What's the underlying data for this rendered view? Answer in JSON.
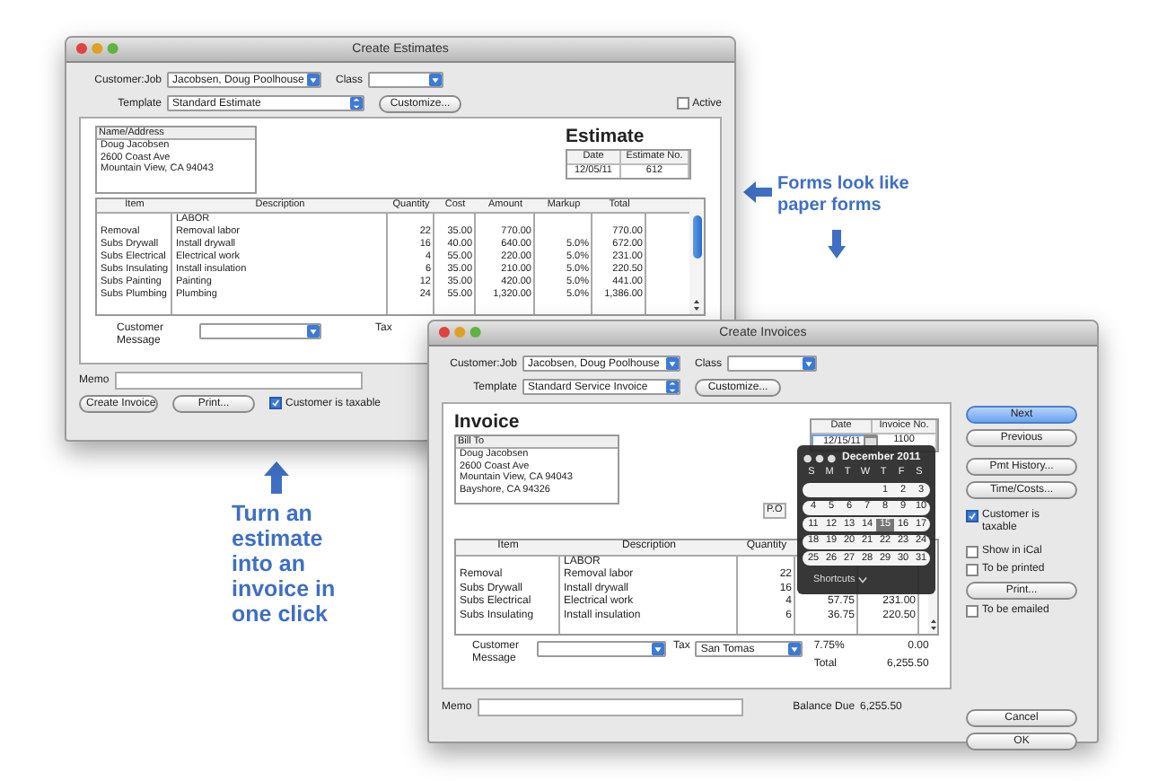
{
  "callout_right": "Forms look like paper forms",
  "callout_left": "Turn an estimate into an invoice in one click",
  "estimate_window": {
    "title": "Create Estimates",
    "customer_job_label": "Customer:Job",
    "customer_job": "Jacobsen, Doug Poolhouse",
    "class_label": "Class",
    "template_label": "Template",
    "template": "Standard Estimate",
    "customize_button": "Customize...",
    "active": {
      "label": "Active",
      "checked": false
    },
    "name_address_label": "Name/Address",
    "address_lines": [
      "Doug Jacobsen",
      "2600 Coast Ave",
      "Mountain View, CA 94043"
    ],
    "form_title": "Estimate",
    "date_label": "Date",
    "date": "12/05/11",
    "number_label": "Estimate No.",
    "number": "612",
    "columns": [
      "Item",
      "Description",
      "Quantity",
      "Cost",
      "Amount",
      "Markup",
      "Total"
    ],
    "rows": [
      {
        "description": "LABOR"
      },
      {
        "item": "Removal",
        "description": "Removal labor",
        "quantity": "22",
        "cost": "35.00",
        "amount": "770.00",
        "total": "770.00"
      },
      {
        "item": "Subs Drywall",
        "description": "Install drywall",
        "quantity": "16",
        "cost": "40.00",
        "amount": "640.00",
        "markup": "5.0%",
        "total": "672.00"
      },
      {
        "item": "Subs Electrical",
        "description": "Electrical work",
        "quantity": "4",
        "cost": "55.00",
        "amount": "220.00",
        "markup": "5.0%",
        "total": "231.00"
      },
      {
        "item": "Subs Insulating",
        "description": "Install insulation",
        "quantity": "6",
        "cost": "35.00",
        "amount": "210.00",
        "markup": "5.0%",
        "total": "220.50"
      },
      {
        "item": "Subs Painting",
        "description": "Painting",
        "quantity": "12",
        "cost": "35.00",
        "amount": "420.00",
        "markup": "5.0%",
        "total": "441.00"
      },
      {
        "item": "Subs Plumbing",
        "description": "Plumbing",
        "quantity": "24",
        "cost": "55.00",
        "amount": "1,320.00",
        "markup": "5.0%",
        "total": "1,386.00"
      }
    ],
    "customer_message_label": "Customer Message",
    "tax_label": "Tax",
    "memo_label": "Memo",
    "buttons": [
      "Create Invoice",
      "Print..."
    ],
    "taxable": {
      "label": "Customer is taxable",
      "checked": true
    }
  },
  "invoice_window": {
    "title": "Create Invoices",
    "customer_job_label": "Customer:Job",
    "customer_job": "Jacobsen, Doug Poolhouse",
    "class_label": "Class",
    "template_label": "Template",
    "template": "Standard Service Invoice",
    "customize_button": "Customize...",
    "form_title": "Invoice",
    "bill_to_label": "Bill To",
    "bill_to_lines": [
      "Doug Jacobsen",
      "2600 Coast Ave",
      "Mountain View, CA 94043",
      "Bayshore, CA 94326"
    ],
    "date_label": "Date",
    "date": "12/15/11",
    "number_label": "Invoice No.",
    "number": "1100",
    "po_label": "P.O",
    "columns": [
      "Item",
      "Description",
      "Quantity"
    ],
    "rows": [
      {
        "description": "LABOR"
      },
      {
        "item": "Removal",
        "description": "Removal labor",
        "quantity": "22"
      },
      {
        "item": "Subs Drywall",
        "description": "Install drywall",
        "quantity": "16"
      },
      {
        "item": "Subs Electrical",
        "description": "Electrical work",
        "quantity": "4",
        "rate": "57.75",
        "amount": "231.00"
      },
      {
        "item": "Subs Insulating",
        "description": "Install insulation",
        "quantity": "6",
        "rate": "36.75",
        "amount": "220.50"
      }
    ],
    "customer_message_label": "Customer Message",
    "tax_label": "Tax",
    "tax_item": "San Tomas",
    "tax_rate": "7.75%",
    "tax_amount": "0.00",
    "total_label": "Total",
    "total": "6,255.50",
    "memo_label": "Memo",
    "balance_due_label": "Balance Due",
    "balance_due": "6,255.50",
    "side_groups": [
      [
        {
          "kind": "button",
          "label": "Next",
          "default": true
        },
        {
          "kind": "button",
          "label": "Previous",
          "default": false
        }
      ],
      [
        {
          "kind": "button",
          "label": "Pmt History...",
          "default": false
        },
        {
          "kind": "button",
          "label": "Time/Costs...",
          "default": false
        }
      ],
      [
        {
          "kind": "checkbox",
          "label": "Customer is taxable",
          "checked": true
        }
      ],
      [
        {
          "kind": "checkbox",
          "label": "Show in iCal",
          "checked": false
        },
        {
          "kind": "checkbox",
          "label": "To be printed",
          "checked": false
        },
        {
          "kind": "button",
          "label": "Print...",
          "default": false
        },
        {
          "kind": "checkbox",
          "label": "To be emailed",
          "checked": false
        }
      ],
      [
        {
          "kind": "button",
          "label": "Cancel",
          "default": false
        },
        {
          "kind": "button",
          "label": "OK",
          "default": false
        }
      ]
    ],
    "calendar": {
      "month": "December 2011",
      "weekdays": [
        "S",
        "M",
        "T",
        "W",
        "T",
        "F",
        "S"
      ],
      "weeks": [
        [
          {
            "day": "1",
            "selected": false
          },
          {
            "day": "2",
            "selected": false
          },
          {
            "day": "3",
            "selected": false
          }
        ],
        [
          {
            "day": "4",
            "selected": false
          },
          {
            "day": "5",
            "selected": false
          },
          {
            "day": "6",
            "selected": false
          },
          {
            "day": "7",
            "selected": false
          },
          {
            "day": "8",
            "selected": false
          },
          {
            "day": "9",
            "selected": false
          },
          {
            "day": "10",
            "selected": false
          }
        ],
        [
          {
            "day": "11",
            "selected": false
          },
          {
            "day": "12",
            "selected": false
          },
          {
            "day": "13",
            "selected": false
          },
          {
            "day": "14",
            "selected": false
          },
          {
            "day": "15",
            "selected": true
          },
          {
            "day": "16",
            "selected": false
          },
          {
            "day": "17",
            "selected": false
          }
        ],
        [
          {
            "day": "18",
            "selected": false
          },
          {
            "day": "19",
            "selected": false
          },
          {
            "day": "20",
            "selected": false
          },
          {
            "day": "21",
            "selected": false
          },
          {
            "day": "22",
            "selected": false
          },
          {
            "day": "23",
            "selected": false
          },
          {
            "day": "24",
            "selected": false
          }
        ],
        [
          {
            "day": "25",
            "selected": false
          },
          {
            "day": "26",
            "selected": false
          },
          {
            "day": "27",
            "selected": false
          },
          {
            "day": "28",
            "selected": false
          },
          {
            "day": "29",
            "selected": false
          },
          {
            "day": "30",
            "selected": false
          },
          {
            "day": "31",
            "selected": false
          }
        ]
      ],
      "shortcuts_label": "Shortcuts"
    }
  }
}
